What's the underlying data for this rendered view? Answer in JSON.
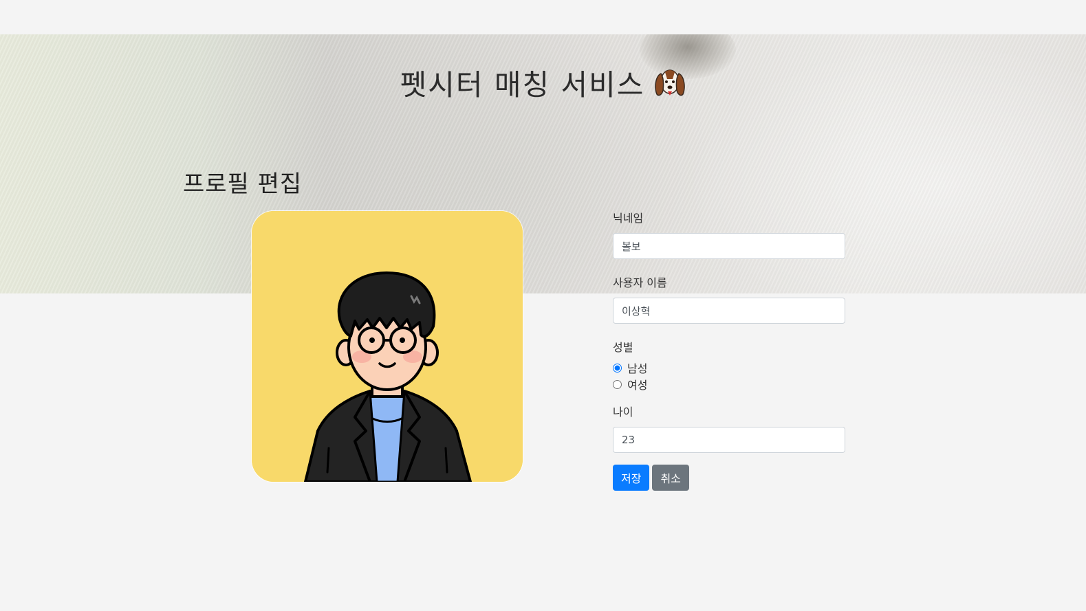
{
  "header": {
    "title": "펫시터 매칭 서비스",
    "title_icon": "dog-face-icon"
  },
  "page": {
    "title": "프로필 편집",
    "avatar_icon": "cartoon-avatar-image"
  },
  "form": {
    "nickname": {
      "label": "닉네임",
      "value": "볼보"
    },
    "username": {
      "label": "사용자 이름",
      "value": "이상혁"
    },
    "gender": {
      "label": "성별",
      "options": [
        {
          "label": "남성",
          "selected": true
        },
        {
          "label": "여성",
          "selected": false
        }
      ]
    },
    "age": {
      "label": "나이",
      "value": "23"
    },
    "save_label": "저장",
    "cancel_label": "취소"
  },
  "colors": {
    "background": "#f4f4f4",
    "avatar_bg": "#f8d96a",
    "primary_button": "#0a7cff",
    "secondary_button": "#6c757d"
  }
}
